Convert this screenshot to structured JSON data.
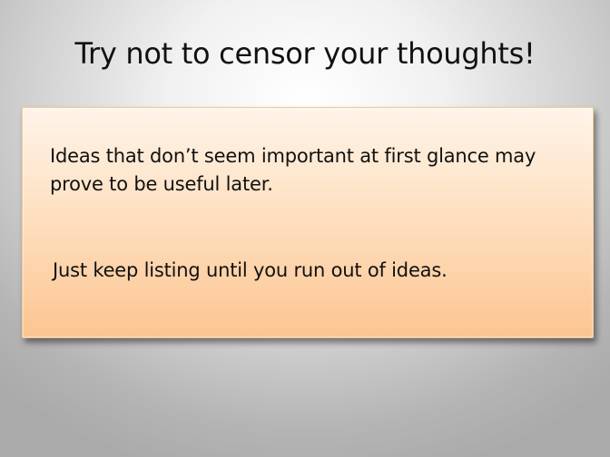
{
  "slide": {
    "title": "Try not to censor your thoughts!",
    "paragraphs": [
      "Ideas that don’t seem important at first glance may prove to be useful later.",
      "Just keep listing until you run out of ideas."
    ]
  }
}
